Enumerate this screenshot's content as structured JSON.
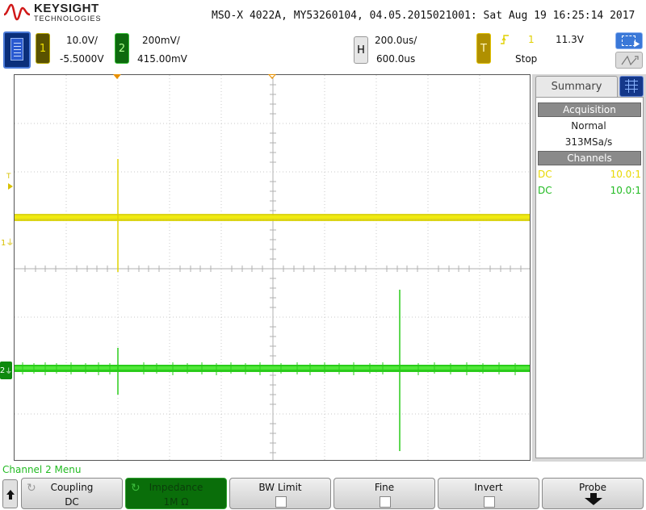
{
  "header": {
    "brand_name": "KEYSIGHT",
    "brand_sub": "TECHNOLOGIES",
    "instrument": "MSO-X 4022A, MY53260104, 04.05.2015021001: Sat Aug 19 16:25:14 2017"
  },
  "channel1": {
    "number": "1",
    "scale": "10.0V/",
    "offset": "-5.5000V",
    "color": "#e8d800"
  },
  "channel2": {
    "number": "2",
    "scale": "200mV/",
    "offset": "415.00mV",
    "color": "#22cc22"
  },
  "horizontal": {
    "badge": "H",
    "time_per_div": "200.0us/",
    "delay": "600.0us"
  },
  "trigger": {
    "badge": "T",
    "source": "1",
    "level": "11.3V",
    "status": "Stop",
    "edge_icon": "rising-edge-icon"
  },
  "graticule_markers": {
    "trigger_level_label": "T",
    "ch1_ground_label": "1",
    "ch2_ground_label": "2"
  },
  "side_panel": {
    "tab_label": "Summary",
    "acquisition_header": "Acquisition",
    "acq_mode": "Normal",
    "sample_rate": "313MSa/s",
    "channels_header": "Channels",
    "channels": [
      {
        "coupling": "DC",
        "probe": "10.0:1"
      },
      {
        "coupling": "DC",
        "probe": "10.0:1"
      }
    ]
  },
  "menu": {
    "title": "Channel 2 Menu",
    "softkeys": [
      {
        "label": "Coupling",
        "value": "DC",
        "active": false,
        "type": "rotary"
      },
      {
        "label": "Impedance",
        "value": "1M Ω",
        "active": true,
        "type": "rotary"
      },
      {
        "label": "BW Limit",
        "value": "",
        "active": false,
        "type": "checkbox",
        "checked": false
      },
      {
        "label": "Fine",
        "value": "",
        "active": false,
        "type": "checkbox",
        "checked": false
      },
      {
        "label": "Invert",
        "value": "",
        "active": false,
        "type": "checkbox",
        "checked": false
      },
      {
        "label": "Probe",
        "value": "",
        "active": false,
        "type": "submenu"
      }
    ]
  }
}
